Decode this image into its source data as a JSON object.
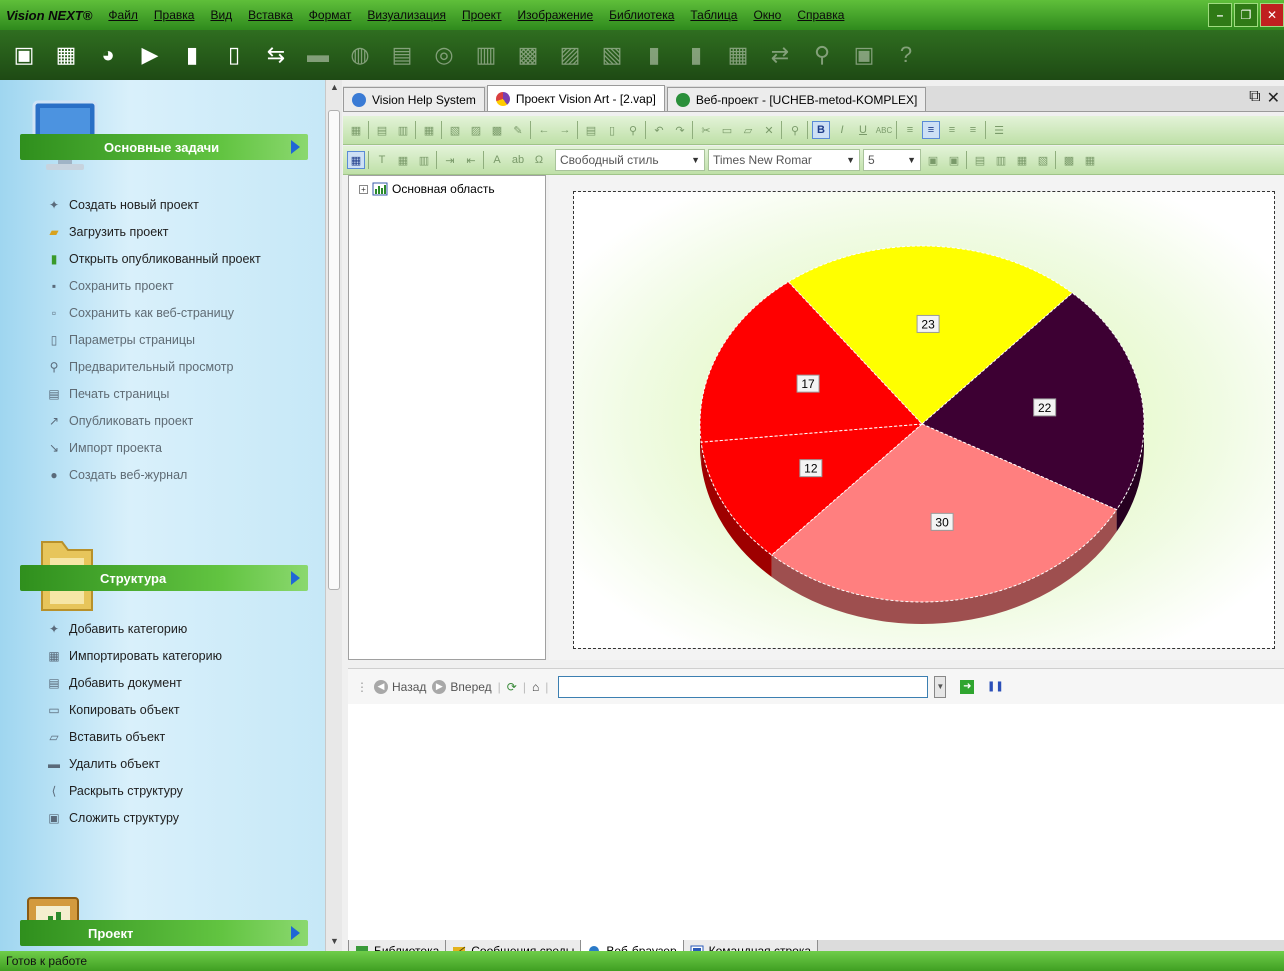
{
  "app": {
    "brand": "Vision NEXT®",
    "menu": [
      "Файл",
      "Правка",
      "Вид",
      "Вставка",
      "Формат",
      "Визуализация",
      "Проект",
      "Изображение",
      "Библиотека",
      "Таблица",
      "Окно",
      "Справка"
    ]
  },
  "taskpanel": {
    "groups": [
      {
        "title": "Основные задачи",
        "items": [
          {
            "label": "Создать новый проект",
            "icon": "new-project-icon",
            "dim": false
          },
          {
            "label": "Загрузить проект",
            "icon": "open-folder-icon",
            "dim": false
          },
          {
            "label": "Открыть опубликованный проект",
            "icon": "published-project-icon",
            "dim": false
          },
          {
            "label": "Сохранить проект",
            "icon": "save-icon",
            "dim": true
          },
          {
            "label": "Сохранить как веб-страницу",
            "icon": "save-web-icon",
            "dim": true
          },
          {
            "label": "Параметры страницы",
            "icon": "page-setup-icon",
            "dim": true
          },
          {
            "label": "Предварительный просмотр",
            "icon": "preview-icon",
            "dim": true
          },
          {
            "label": "Печать страницы",
            "icon": "print-icon",
            "dim": true
          },
          {
            "label": "Опубликовать проект",
            "icon": "publish-icon",
            "dim": true
          },
          {
            "label": "Импорт проекта",
            "icon": "import-icon",
            "dim": true
          },
          {
            "label": "Создать веб-журнал",
            "icon": "blog-icon",
            "dim": true
          }
        ]
      },
      {
        "title": "Структура",
        "items": [
          {
            "label": "Добавить категорию",
            "icon": "add-category-icon",
            "dim": false
          },
          {
            "label": "Импортировать категорию",
            "icon": "import-category-icon",
            "dim": false
          },
          {
            "label": "Добавить документ",
            "icon": "add-document-icon",
            "dim": false
          },
          {
            "label": "Копировать объект",
            "icon": "copy-icon",
            "dim": false
          },
          {
            "label": "Вставить объект",
            "icon": "paste-icon",
            "dim": false
          },
          {
            "label": "Удалить объект",
            "icon": "delete-icon",
            "dim": false
          },
          {
            "label": "Раскрыть структуру",
            "icon": "expand-icon",
            "dim": false
          },
          {
            "label": "Сложить структуру",
            "icon": "collapse-icon",
            "dim": false
          }
        ]
      },
      {
        "title": "Проект",
        "items": []
      }
    ]
  },
  "doctabs": [
    {
      "label": "Vision Help System",
      "active": false,
      "icon_color": "#3a7bd5"
    },
    {
      "label": "Проект Vision Art - [2.vap]",
      "active": true,
      "icon_color": "#7a3fb0"
    },
    {
      "label": "Веб-проект - [UCHEB-metod-KOMPLEX]",
      "active": false,
      "icon_color": "#2a8f3a"
    }
  ],
  "formatbar": {
    "style": "Свободный стиль",
    "font": "Times New Romar",
    "size": "5"
  },
  "tree": {
    "root": "Основная область",
    "expander": "+"
  },
  "chart_data": {
    "type": "pie",
    "style": "3d",
    "values": [
      23,
      22,
      30,
      12,
      17
    ],
    "colors": [
      "#ffff00",
      "#3d0033",
      "#ff7f7f",
      "#ff0000",
      "#ff0000"
    ],
    "labels": [
      "23",
      "22",
      "30",
      "12",
      "17"
    ]
  },
  "browser": {
    "back": "Назад",
    "forward": "Вперед",
    "url": ""
  },
  "bottomtabs": [
    {
      "label": "Библиотека",
      "active": false
    },
    {
      "label": "Сообщения среды",
      "active": false
    },
    {
      "label": "Веб-браузер",
      "active": true
    },
    {
      "label": "Командная строка",
      "active": false
    }
  ],
  "status": "Готов к работе"
}
